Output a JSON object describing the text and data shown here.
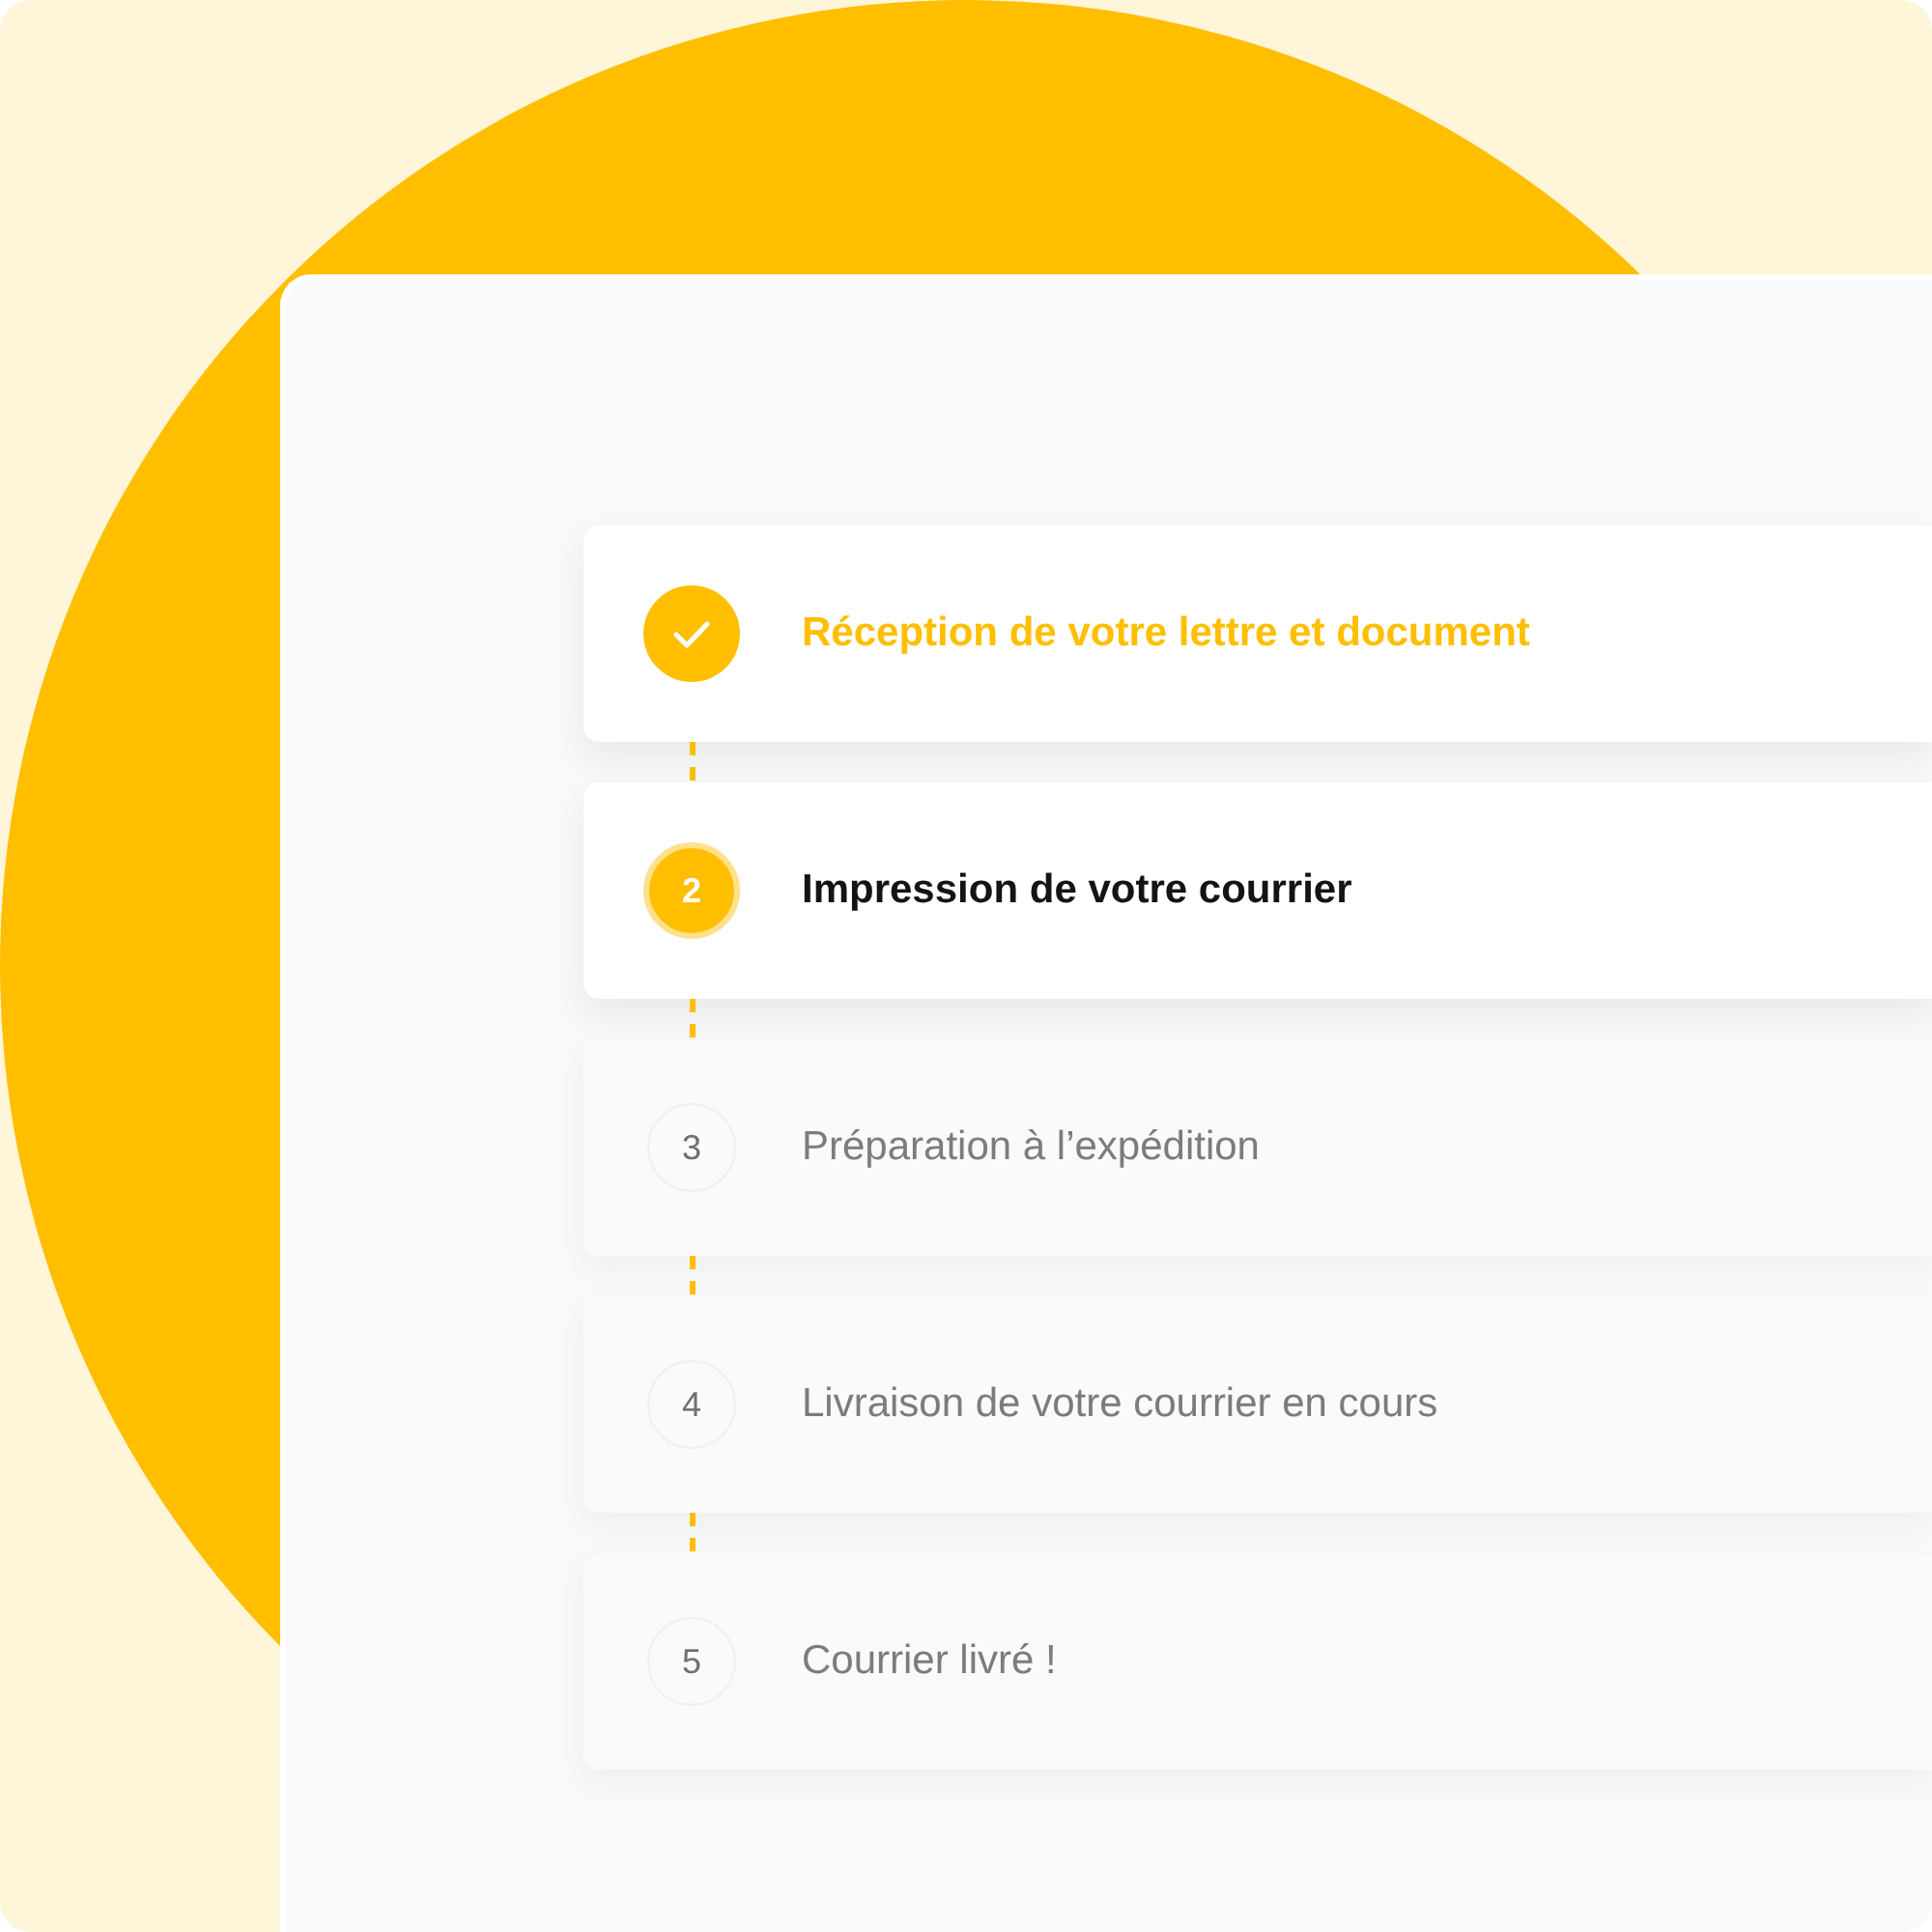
{
  "steps": [
    {
      "kind": "done",
      "label": "Réception de votre lettre et document"
    },
    {
      "kind": "current",
      "number": "2",
      "label": "Impression de votre courrier"
    },
    {
      "kind": "pending",
      "number": "3",
      "label": "Préparation à l’expédition"
    },
    {
      "kind": "pending",
      "number": "4",
      "label": "Livraison de votre courrier en cours"
    },
    {
      "kind": "pending",
      "number": "5",
      "label": "Courrier livré !"
    }
  ]
}
